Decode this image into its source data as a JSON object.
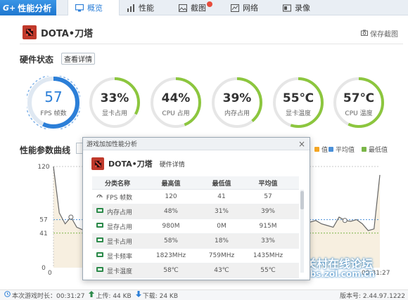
{
  "app": {
    "logo_mark": "G+",
    "logo_text": "性能分析"
  },
  "tabs": [
    {
      "label": "概览",
      "icon": "monitor-icon",
      "active": true
    },
    {
      "label": "性能",
      "icon": "bar-chart-icon",
      "active": false
    },
    {
      "label": "截图",
      "icon": "image-icon",
      "active": false
    },
    {
      "label": "网络",
      "icon": "network-icon",
      "active": false
    },
    {
      "label": "录像",
      "icon": "video-icon",
      "active": false
    }
  ],
  "game": {
    "title": "DOTA•刀塔",
    "save_label": "保存截图"
  },
  "hardware": {
    "title": "硬件状态",
    "detail_button": "查看详情",
    "gauges": [
      {
        "value": "57",
        "label": "FPS 帧数",
        "level": 0.57,
        "color": "#2c7fd8"
      },
      {
        "value": "33%",
        "label": "显卡占用",
        "level": 0.33,
        "color": "#8cc63e"
      },
      {
        "value": "44%",
        "label": "CPU 占用",
        "level": 0.44,
        "color": "#8cc63e"
      },
      {
        "value": "39%",
        "label": "内存占用",
        "level": 0.39,
        "color": "#8cc63e"
      },
      {
        "value": "55℃",
        "label": "显卡温度",
        "level": 0.55,
        "color": "#8cc63e"
      },
      {
        "value": "57℃",
        "label": "CPU 温度",
        "level": 0.57,
        "color": "#8cc63e"
      }
    ]
  },
  "curve": {
    "title": "性能参数曲线",
    "legend": [
      {
        "label": "值",
        "color": "#f5a623"
      },
      {
        "label": "平均值",
        "color": "#4a90d9"
      },
      {
        "label": "最低值",
        "color": "#7ab648"
      }
    ]
  },
  "chart_data": {
    "type": "line",
    "y_ticks": [
      120,
      57,
      41,
      0
    ],
    "x_labels": [
      "0",
      "00:31:27"
    ],
    "ylim": [
      0,
      120
    ],
    "series": [
      {
        "values": [
          120,
          65,
          52,
          60,
          48,
          45,
          41,
          44,
          52,
          50,
          48,
          55,
          60,
          57,
          58,
          56,
          54,
          58,
          60,
          57,
          55,
          56,
          57,
          58,
          57,
          54,
          55,
          56,
          57,
          58,
          57,
          59,
          58,
          57,
          56,
          55,
          56,
          57,
          58,
          57,
          56,
          60,
          58,
          55,
          54,
          56,
          52,
          50,
          48,
          60,
          56,
          55,
          57,
          52,
          44,
          46,
          110
        ]
      }
    ],
    "avg": 57,
    "min": 41
  },
  "modal": {
    "title": "游戏加加性能分析",
    "game_title": "DOTA•刀塔",
    "subtitle": "硬件详情",
    "headers": [
      "分类名称",
      "最高值",
      "最低值",
      "平均值"
    ],
    "rows": [
      {
        "name": "FPS 帧数",
        "icon": "fps-gauge-icon",
        "max": "120",
        "min": "41",
        "avg": "57"
      },
      {
        "name": "内存占用",
        "icon": "memory-icon",
        "max": "48%",
        "min": "31%",
        "avg": "39%"
      },
      {
        "name": "显存占用",
        "icon": "vram-icon",
        "max": "980M",
        "min": "0M",
        "avg": "915M"
      },
      {
        "name": "显卡占用",
        "icon": "gpu-icon",
        "max": "58%",
        "min": "18%",
        "avg": "33%"
      },
      {
        "name": "显卡频率",
        "icon": "gpu-clock-icon",
        "max": "1823MHz",
        "min": "759MHz",
        "avg": "1435MHz"
      },
      {
        "name": "显卡温度",
        "icon": "gpu-temp-icon",
        "max": "58℃",
        "min": "43℃",
        "avg": "55℃"
      }
    ]
  },
  "statusbar": {
    "session_label": "本次游戏时长：00:31:27",
    "upload_label": "上传: 44 KB",
    "download_label": "下载: 24 KB",
    "version_label": "版本号: 2.44.97.1222"
  },
  "watermark": {
    "text": "中关村在线论坛",
    "url": "bbs.zol.com.cn"
  }
}
